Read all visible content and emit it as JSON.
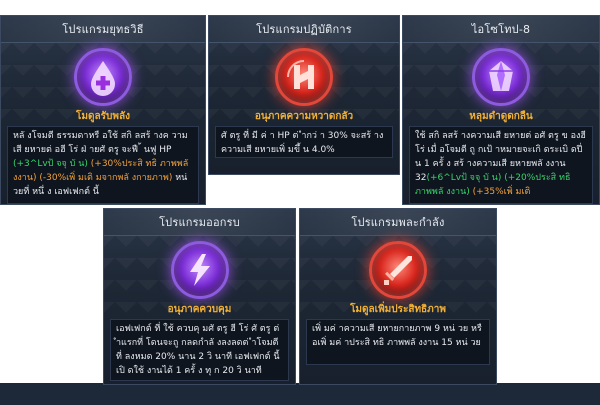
{
  "cards": [
    {
      "title": "โปรแกรมยุทธวิธี",
      "item_name": "โมดูลรับพลัง",
      "icon": "purple-heal-chip-icon",
      "desc": {
        "text1": "หลั งโจมตี ธรรมดาหรื อใช้ สกิ ลสร้ างค วามเสี ยหายต่ อฮี โร่ ฝ่ ายศั ตรู จะฟื ้ นฟู HP ",
        "green1": "(+3^Lvป้ จจุ บั น)",
        "text2": " ",
        "orange1": "(+30%ประสิ ทธิ ภาพพลั งงาน)",
        "text3": " ",
        "green2": "(-30%เพิ่ มเติ มจากพลั งกายภาพ)",
        "text4": " หน่ วยที่ หนึ่ ง เอฟเฟกต์ นี้"
      }
    },
    {
      "title": "โปรแกรมปฏิบัติการ",
      "item_name": "อนุภาคความหวาดกลัว",
      "icon": "red-h-chip-icon",
      "desc": {
        "text1": "ศั ตรู ที่ มี ค่ า HP ต่ ำกว่ า 30% จะสร้ างความเสี ยหายเพิ่ มขึ้ น 4.0%"
      }
    },
    {
      "title": "ไอโซโทป-8",
      "item_name": "หลุมดำดูดกลืน",
      "icon": "purple-crystal-chip-icon",
      "desc": {
        "text1": "ใช้ สกิ ลสร้ างความเสี ยหายต่ อศั ตรู ข องฮี โร่ เมื่ อโจมตี ถู กเป้ าหมายจะเกิ ดระเบิ ดปี่ น 1 ครั้ ง สร้ างความเสี ยหายพลั งงาน 32",
        "green1": "(+6^Lvป้ จจุ บั น)",
        "text2": " ",
        "orange1": "(+20%ประสิ ทธิ ภาพพลั งงาน)",
        "text3": " ",
        "green2": "(+35%เพิ่ มเติ"
      }
    },
    {
      "title": "โปรแกรมออกรบ",
      "item_name": "อนุภาคควบคุม",
      "icon": "purple-lightning-chip-icon",
      "desc": {
        "text1": "เอฟเฟกต์ ที่ ใช้ ควบคุ มศั ตรู ฮี โร่ ศั ตรู ต่ ำแรกที่ โดนจะถู กลดกำลั งลงลดต่ ำโจมตี ที่ ลงหมด 20% นาน 2 วิ นาที เอฟเฟกต์ นี้ เปิ ดใช้ งานได้ 1 ครั้ ง ทุ ก 20 วิ นาที"
      }
    },
    {
      "title": "โปรแกรมพละกำลัง",
      "item_name": "โมดูลเพิ่มประสิทธิภาพ",
      "icon": "red-sword-chip-icon",
      "desc": {
        "text1": "เพิ่ มค่ าความเสี ยหายกายภาพ 9 หน่ วย หรื อเพิ่ มค่ าประสิ ทธิ ภาพพลั งงาน 15 หน่ วย"
      }
    }
  ]
}
